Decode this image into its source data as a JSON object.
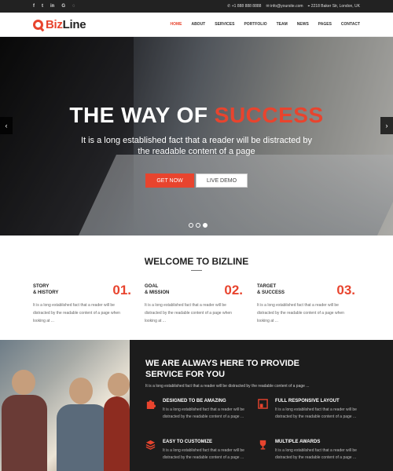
{
  "topbar": {
    "socials": [
      "f",
      "t",
      "in",
      "G",
      "rss"
    ],
    "phone": "+1 888 888 8888",
    "email": "info@yoursite.com",
    "address": "2218 Baker Str, London, UK"
  },
  "brand": {
    "prefix": "Biz",
    "suffix": "Line"
  },
  "nav": [
    "HOME",
    "ABOUT",
    "SERVICES",
    "PORTFOLIO",
    "TEAM",
    "NEWS",
    "PAGES",
    "CONTACT"
  ],
  "hero": {
    "title_part1": "THE WAY OF",
    "title_part2": "SUCCESS",
    "subtitle": "It is a long established fact that a reader will be distracted by the readable content of a page",
    "button_primary": "GET NOW",
    "button_secondary": "LIVE DEMO",
    "slides_total": 3,
    "current_slide": 3
  },
  "welcome": {
    "heading": "WELCOME TO BIZLINE",
    "features": [
      {
        "line1": "STORY",
        "line2": "& HISTORY",
        "number": "01.",
        "text": "It is a long established fact that a reader will be distracted by the readable content of a page when looking at ..."
      },
      {
        "line1": "GOAL",
        "line2": "& MISSION",
        "number": "02.",
        "text": "It is a long established fact that a reader will be distracted by the readable content of a page when looking at ..."
      },
      {
        "line1": "TARGET",
        "line2": "& SUCCESS",
        "number": "03.",
        "text": "It is a long established fact that a reader will be distracted by the readable content of a page when looking at ..."
      }
    ]
  },
  "services": {
    "heading": "WE ARE ALWAYS HERE TO PROVIDE SERVICE FOR YOU",
    "intro": "It is a long established fact that a reader will be distracted by the readable content of a page ...",
    "items": [
      {
        "title": "DESIGNED TO BE AMAZING",
        "text": "It is a long established fact that a reader will be distracted by the readable content of a page ..."
      },
      {
        "title": "FULL RESPONSIVE LAYOUT",
        "text": "It is a long established fact that a reader will be distracted by the readable content of a page ..."
      },
      {
        "title": "EASY TO CUSTOMIZE",
        "text": "It is a long established fact that a reader will be distracted by the readable content of a page ..."
      },
      {
        "title": "MULTIPLE AWARDS",
        "text": "It is a long established fact that a reader will be distracted by the readable content of a page ..."
      }
    ]
  },
  "colors": {
    "accent": "#e8442e",
    "dark": "#1c1c1c",
    "topbar": "#222222"
  }
}
